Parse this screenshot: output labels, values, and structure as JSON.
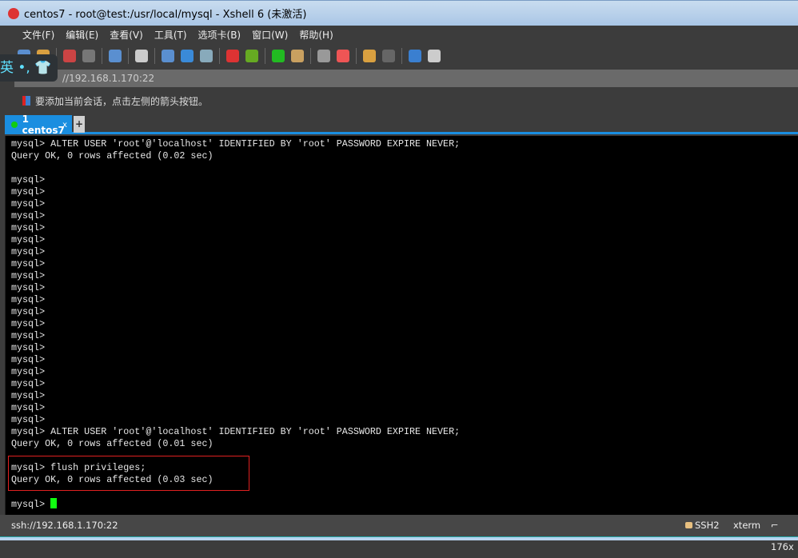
{
  "window": {
    "title": "centos7 - root@test:/usr/local/mysql - Xshell 6 (未激活)"
  },
  "menu": [
    "文件(F)",
    "编辑(E)",
    "查看(V)",
    "工具(T)",
    "选项卡(B)",
    "窗口(W)",
    "帮助(H)"
  ],
  "toolbar_icons": [
    "new-session-icon",
    "open-icon",
    "disconnect-icon",
    "reconnect-icon",
    "new-window-icon",
    "find-icon",
    "color-scheme-icon",
    "globe-icon",
    "font-icon",
    "xshell-icon",
    "xftp-icon",
    "fullscreen-icon",
    "lock-icon",
    "keyboard-icon",
    "highlight-icon",
    "folder-add-icon",
    "layout-icon",
    "help-icon",
    "chat-icon"
  ],
  "ime": {
    "text": "英 •, 👕"
  },
  "address": {
    "value": "//192.168.1.170:22"
  },
  "hint": {
    "text": "要添加当前会话，点击左侧的箭头按钮。"
  },
  "tabs": [
    {
      "label": "1 centos7",
      "close": "x"
    }
  ],
  "tab_add": "+",
  "terminal": {
    "lines": [
      "mysql> ALTER USER 'root'@'localhost' IDENTIFIED BY 'root' PASSWORD EXPIRE NEVER;",
      "Query OK, 0 rows affected (0.02 sec)",
      "",
      "mysql>",
      "mysql>",
      "mysql>",
      "mysql>",
      "mysql>",
      "mysql>",
      "mysql>",
      "mysql>",
      "mysql>",
      "mysql>",
      "mysql>",
      "mysql>",
      "mysql>",
      "mysql>",
      "mysql>",
      "mysql>",
      "mysql>",
      "mysql>",
      "mysql>",
      "mysql>",
      "mysql>",
      "mysql> ALTER USER 'root'@'localhost' IDENTIFIED BY 'root' PASSWORD EXPIRE NEVER;",
      "Query OK, 0 rows affected (0.01 sec)",
      "",
      "mysql> flush privileges;",
      "Query OK, 0 rows affected (0.03 sec)",
      ""
    ],
    "prompt": "mysql> "
  },
  "status": {
    "address": "ssh://192.168.1.170:22",
    "protocol": "SSH2",
    "terminal": "xterm",
    "size": "176x"
  },
  "colors": {
    "cursor": "#11ff11",
    "tab_active": "#1a8ee0",
    "highlight_box": "#e02020"
  }
}
